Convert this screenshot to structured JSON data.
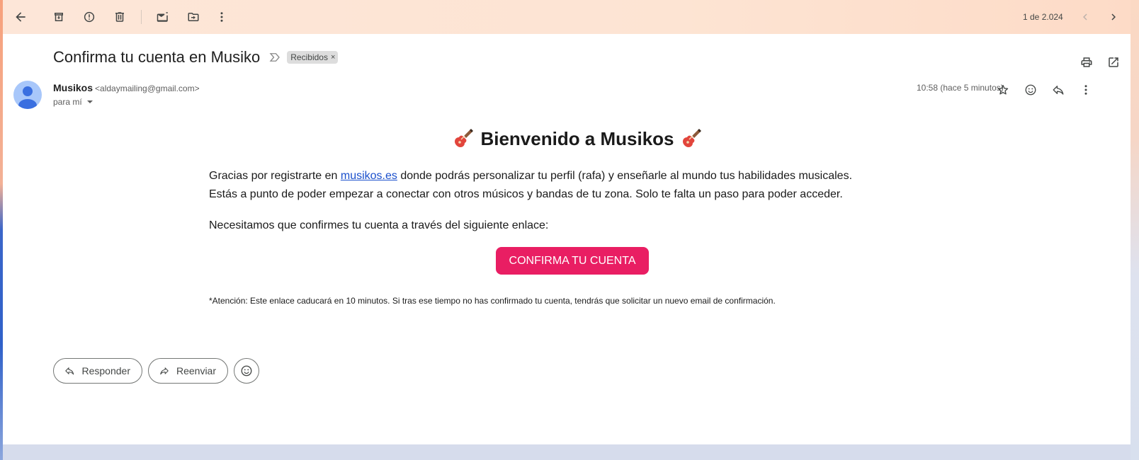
{
  "toolbar": {
    "back": "back-arrow-icon",
    "archive": "archive-icon",
    "report_spam": "report-spam-icon",
    "delete": "trash-icon",
    "mark_unread": "mark-unread-icon",
    "move_to": "move-to-folder-icon",
    "more": "more-vert-icon",
    "count_label": "1 de 2.024"
  },
  "header": {
    "subject": "Confirma tu cuenta en Musiko",
    "label_chip": "Recibidos",
    "label_chip_close": "×"
  },
  "sender": {
    "name": "Musikos",
    "email": "<aldaymailing@gmail.com>",
    "to": "para mí",
    "timestamp": "10:58 (hace 5 minutos)"
  },
  "body": {
    "title": "Bienvenido a Musikos",
    "para1_before": "Gracias por registrarte en ",
    "para1_link": "musikos.es",
    "para1_after": " donde podrás personalizar tu perfil (rafa) y enseñarle al mundo tus habilidades musicales.",
    "para1_line2": "Estás a punto de poder empezar a conectar con otros músicos y bandas de tu zona. Solo te falta un paso para poder acceder.",
    "para2": "Necesitamos que confirmes tu cuenta a través del siguiente enlace:",
    "confirm_button": "CONFIRMA TU CUENTA",
    "notice": "*Atención: Este enlace caducará en 10 minutos. Si tras ese tiempo no has confirmado tu cuenta, tendrás que solicitar un nuevo email de confirmación."
  },
  "actions": {
    "reply": "Responder",
    "forward": "Reenviar"
  },
  "colors": {
    "confirm_button": "#e91e63",
    "link": "#1a4fcc",
    "avatar": "#a8c7fa"
  }
}
